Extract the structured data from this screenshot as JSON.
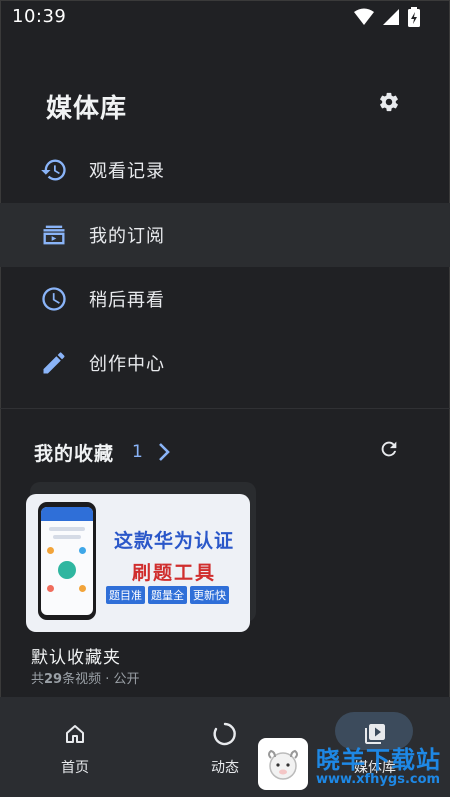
{
  "status_bar": {
    "time": "10:39",
    "icons": [
      "wifi-icon",
      "signal-icon",
      "battery-charging-icon"
    ]
  },
  "header": {
    "title": "媒体库",
    "settings_icon": "gear-icon"
  },
  "menu": [
    {
      "label": "观看记录",
      "icon": "history-icon"
    },
    {
      "label": "我的订阅",
      "icon": "subscriptions-icon",
      "active": true
    },
    {
      "label": "稍后再看",
      "icon": "clock-icon"
    },
    {
      "label": "创作中心",
      "icon": "pencil-icon"
    }
  ],
  "favorites": {
    "title": "我的收藏",
    "count": "1",
    "refresh_icon": "refresh-icon",
    "folders": [
      {
        "name": "默认收藏夹",
        "meta_prefix": "共",
        "meta_count": "29",
        "meta_suffix": "条视频 · 公开",
        "thumbnail": {
          "line1": "这款华为认证",
          "line2": "刷题工具",
          "tags": [
            "题目准",
            "题量全",
            "更新快"
          ]
        }
      }
    ]
  },
  "bottom_nav": [
    {
      "label": "首页",
      "icon": "home-icon"
    },
    {
      "label": "动态",
      "icon": "loading-ring-icon"
    },
    {
      "label": "媒体库",
      "icon": "media-library-icon",
      "selected": true
    }
  ],
  "watermark": {
    "title": "晓羊下载站",
    "url": "www.xfhygs.com"
  },
  "colors": {
    "background": "#202124",
    "accent_icon": "#8ab4f8",
    "nav_background": "#2b2d31",
    "selected_pill": "#3c4b5c"
  }
}
